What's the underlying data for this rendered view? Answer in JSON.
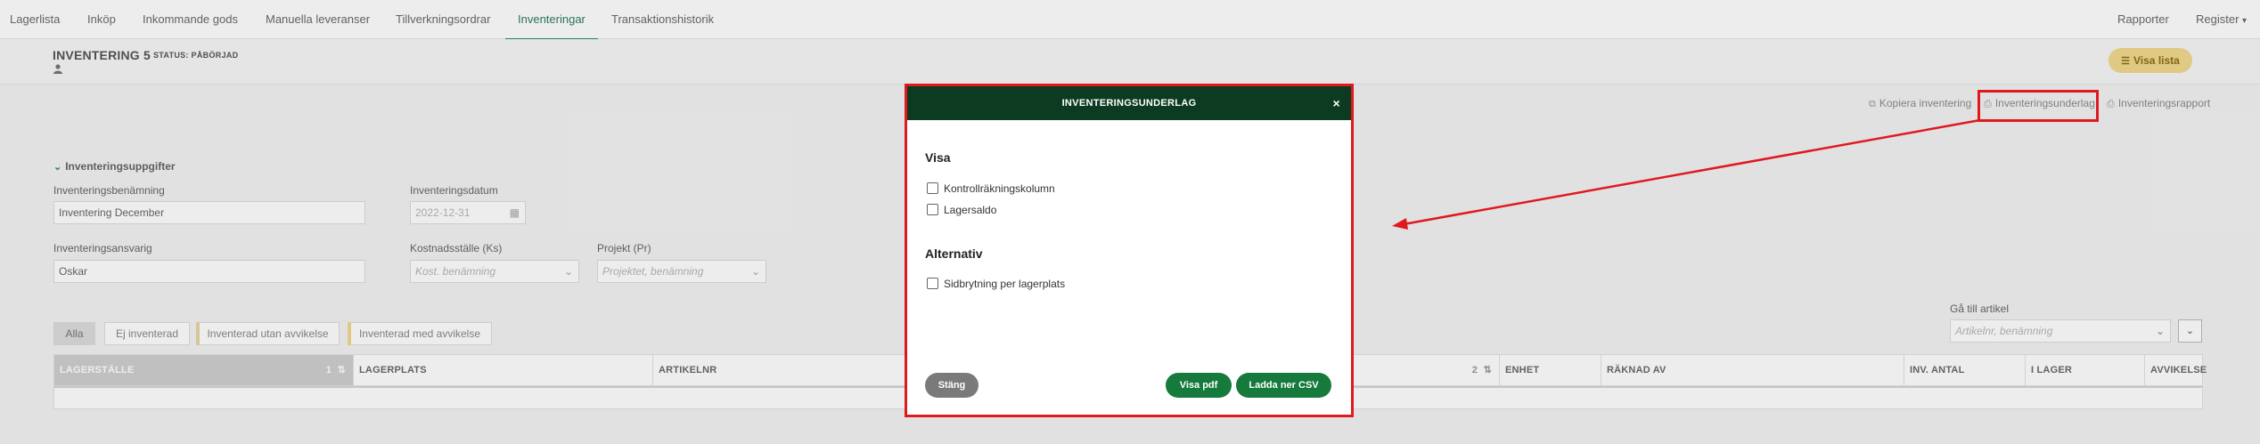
{
  "nav": {
    "tabs": [
      {
        "label": "Lagerlista"
      },
      {
        "label": "Inköp"
      },
      {
        "label": "Inkommande gods"
      },
      {
        "label": "Manuella leveranser"
      },
      {
        "label": "Tillverkningsordrar"
      },
      {
        "label": "Inventeringar",
        "active": true
      },
      {
        "label": "Transaktionshistorik"
      }
    ],
    "right": {
      "reports": "Rapporter",
      "register": "Register",
      "register_caret": "▾"
    }
  },
  "header": {
    "title": "INVENTERING 5",
    "status": "STATUS: PÅBÖRJAD",
    "visa_lista": "Visa lista"
  },
  "actions": {
    "copy": "Kopiera inventering",
    "underlag": "Inventeringsunderlag",
    "rapport": "Inventeringsrapport"
  },
  "form": {
    "section_title": "Inventeringsuppgifter",
    "name_label": "Inventeringsbenämning",
    "name_value": "Inventering December",
    "date_label": "Inventeringsdatum",
    "date_value": "2022-12-31",
    "responsible_label": "Inventeringsansvarig",
    "responsible_value": "Oskar",
    "cost_label": "Kostnadsställe (Ks)",
    "cost_placeholder": "Kost. benämning",
    "project_label": "Projekt (Pr)",
    "project_placeholder": "Projektet, benämning"
  },
  "filters": {
    "all": "Alla",
    "not_inventoried": "Ej inventerad",
    "without_deviation": "Inventerad utan avvikelse",
    "with_deviation": "Inventerad med avvikelse",
    "goto_label": "Gå till artikel",
    "goto_placeholder": "Artikelnr, benämning"
  },
  "table": {
    "columns": [
      "LAGERSTÄLLE",
      "LAGERPLATS",
      "ARTIKELNR",
      "ENHET",
      "RÄKNAD AV",
      "INV. ANTAL",
      "I LAGER",
      "AVVIKELSE"
    ],
    "sort1": "1",
    "sort2": "2"
  },
  "modal": {
    "title": "INVENTERINGSUNDERLAG",
    "close": "×",
    "visa_heading": "Visa",
    "opt_control": "Kontrollräkningskolumn",
    "opt_stock": "Lagersaldo",
    "alt_heading": "Alternativ",
    "opt_pagebreak": "Sidbrytning per lagerplats",
    "btn_close": "Stäng",
    "btn_pdf": "Visa pdf",
    "btn_csv": "Ladda ner CSV"
  },
  "colors": {
    "accent_green": "#157a3b",
    "modal_header": "#0d3b22",
    "highlight_red": "#e0191f",
    "visa_lista_bg": "#f0d98d",
    "filter_without_deviation": "#e7d7a6",
    "filter_with_deviation": "#f3d98e"
  }
}
